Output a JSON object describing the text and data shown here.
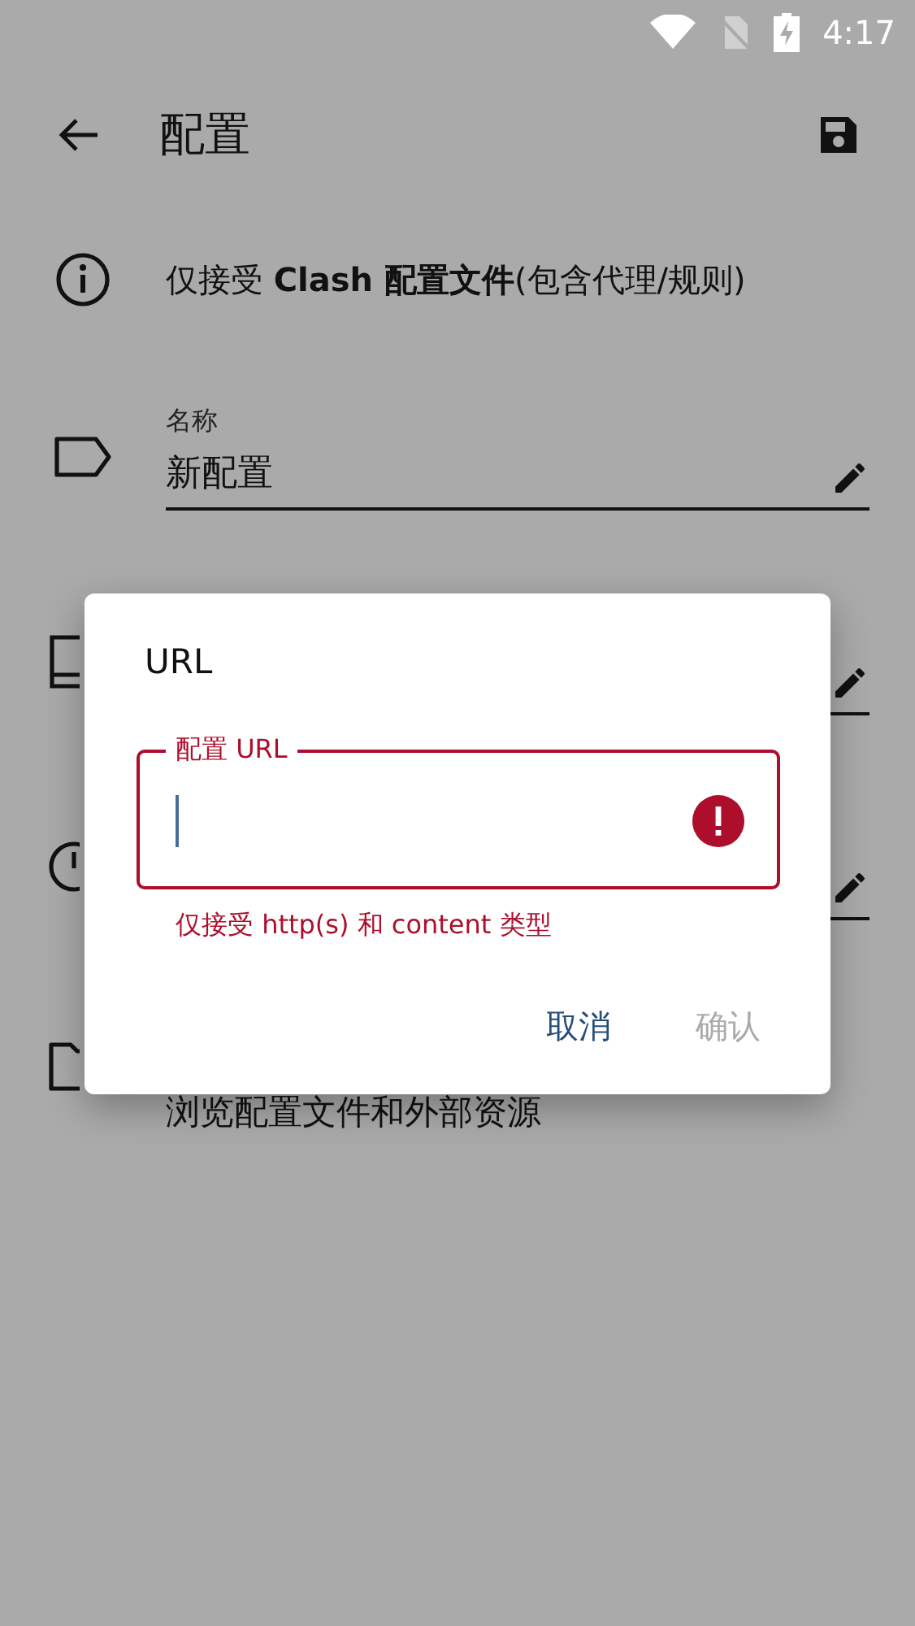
{
  "status_bar": {
    "time": "4:17",
    "charging": true
  },
  "app_bar": {
    "title": "配置"
  },
  "info": {
    "text": "仅接受 **Clash 配置文件**(包含代理/规则)"
  },
  "rows": [
    {
      "kind": "field",
      "label": "名称",
      "value": "新配置"
    },
    {
      "kind": "field"
    },
    {
      "kind": "field"
    },
    {
      "kind": "link",
      "text": "浏览配置文件和外部资源"
    }
  ],
  "dialog": {
    "title": "URL",
    "field": {
      "label": "配置 URL",
      "focused": true,
      "error": true,
      "helper": "仅接受 http(s) 和 content 类型"
    },
    "buttons": [
      {
        "label": "取消",
        "disabled": false
      },
      {
        "label": "确认",
        "disabled": true
      }
    ]
  }
}
